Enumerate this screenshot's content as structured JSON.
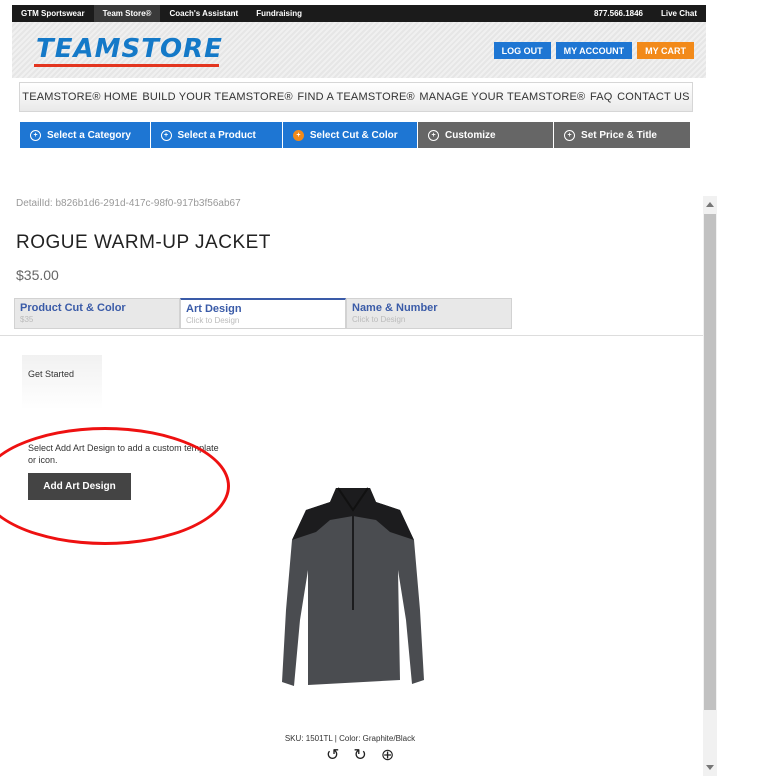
{
  "topbar": {
    "links": [
      "GTM Sportswear",
      "Team Store®",
      "Coach's Assistant",
      "Fundraising"
    ],
    "phone": "877.566.1846",
    "chat": "Live Chat"
  },
  "header": {
    "logo": "TEAMSTORE",
    "logout": "LOG OUT",
    "account": "MY ACCOUNT",
    "cart": "MY CART"
  },
  "nav": [
    "TEAMSTORE® HOME",
    "BUILD YOUR TEAMSTORE®",
    "FIND A TEAMSTORE®",
    "MANAGE YOUR TEAMSTORE®",
    "FAQ",
    "CONTACT US"
  ],
  "steps": [
    "Select a Category",
    "Select a Product",
    "Select Cut & Color",
    "Customize",
    "Set Price & Title"
  ],
  "product": {
    "detail_id": "DetailId: b826b1d6-291d-417c-98f0-917b3f56ab67",
    "title": "ROGUE WARM-UP JACKET",
    "price": "$35.00",
    "sku": "SKU: 1501TL  |  Color: Graphite/Black"
  },
  "tabs": [
    {
      "title": "Product Cut & Color",
      "sub": "$35"
    },
    {
      "title": "Art Design",
      "sub": "Click to Design"
    },
    {
      "title": "Name & Number",
      "sub": "Click to Design"
    }
  ],
  "design": {
    "get_started": "Get Started",
    "instructions": "Select Add Art Design to add a custom template or icon.",
    "add_button": "Add Art Design"
  },
  "colors": {
    "accent_blue": "#1e76d3",
    "accent_orange": "#f28a1a",
    "highlight_red": "#e11111"
  }
}
